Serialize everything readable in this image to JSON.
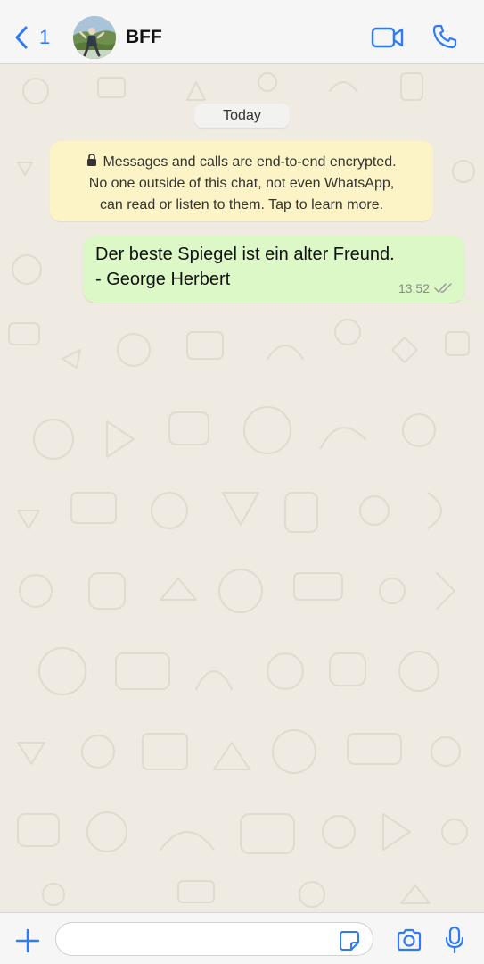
{
  "colors": {
    "accent": "#2f7bf5",
    "chat_background": "#efeae2",
    "outgoing_bubble": "#dcf8c6",
    "encryption_notice_bg": "#fcf4c6",
    "header_bg": "#f6f6f6"
  },
  "header": {
    "back_count": "1",
    "contact_name": "BFF",
    "icons": [
      "chevron-left-icon",
      "avatar",
      "video-call-icon",
      "phone-icon"
    ]
  },
  "chat": {
    "date_label": "Today",
    "encryption_notice": {
      "line1": "Messages and calls are end-to-end encrypted.",
      "line2": "No one outside of this chat, not even WhatsApp,",
      "line3": "can read or listen to them. Tap to learn more."
    },
    "messages": [
      {
        "direction": "outgoing",
        "line1": "Der beste Spiegel ist ein alter Freund.",
        "line2": "- George Herbert",
        "time": "13:52",
        "status": "delivered"
      }
    ]
  },
  "composer": {
    "input_value": "",
    "icons": [
      "plus-icon",
      "sticker-icon",
      "camera-icon",
      "microphone-icon"
    ]
  }
}
